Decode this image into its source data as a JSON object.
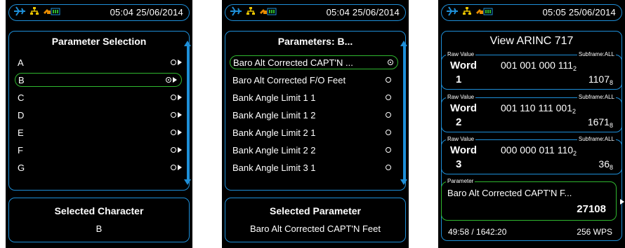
{
  "colors": {
    "accent_blue": "#1e8fd8",
    "selection_green": "#2fb72f",
    "background": "#000000",
    "text": "#ffffff"
  },
  "screen1": {
    "status": {
      "time": "05:04 25/06/2014",
      "icons": [
        "airplane-icon",
        "network-icon",
        "battery-icon"
      ]
    },
    "list_title": "Parameter Selection",
    "items": [
      {
        "label": "A",
        "selected": false
      },
      {
        "label": "B",
        "selected": true
      },
      {
        "label": "C",
        "selected": false
      },
      {
        "label": "D",
        "selected": false
      },
      {
        "label": "E",
        "selected": false
      },
      {
        "label": "F",
        "selected": false
      },
      {
        "label": "G",
        "selected": false
      }
    ],
    "footer_title": "Selected Character",
    "footer_value": "B"
  },
  "screen2": {
    "status": {
      "time": "05:04 25/06/2014"
    },
    "list_title": "Parameters: B...",
    "items": [
      {
        "label": "Baro Alt Corrected CAPT'N ...",
        "selected": true
      },
      {
        "label": "Baro Alt Corrected F/O  Feet",
        "selected": false
      },
      {
        "label": "Bank Angle Limit 1 1",
        "selected": false
      },
      {
        "label": "Bank Angle Limit 1 2",
        "selected": false
      },
      {
        "label": "Bank Angle Limit 2 1",
        "selected": false
      },
      {
        "label": "Bank Angle Limit 2 2",
        "selected": false
      },
      {
        "label": "Bank Angle Limit 3 1",
        "selected": false
      }
    ],
    "footer_title": "Selected Parameter",
    "footer_value": "Baro Alt Corrected CAPT'N  Feet"
  },
  "screen3": {
    "status": {
      "time": "05:05 25/06/2014"
    },
    "title": "View ARINC 717",
    "words": [
      {
        "legend_left": "Raw Value",
        "legend_right": "Subframe:ALL",
        "word_label": "Word",
        "index": "1",
        "binary": "001 001 000 111",
        "binary_base": "2",
        "octal": "1107",
        "octal_base": "8"
      },
      {
        "legend_left": "Raw Value",
        "legend_right": "Subframe:ALL",
        "word_label": "Word",
        "index": "2",
        "binary": "001 110 111 001",
        "binary_base": "2",
        "octal": "1671",
        "octal_base": "8"
      },
      {
        "legend_left": "Raw Value",
        "legend_right": "Subframe:ALL",
        "word_label": "Word",
        "index": "3",
        "binary": "000 000 011 110",
        "binary_base": "2",
        "octal": "36",
        "octal_base": "8"
      }
    ],
    "parameter": {
      "legend": "Parameter",
      "name": "Baro Alt Corrected CAPT'N  F...",
      "value": "27108"
    },
    "footer_left": "49:58 / 1642:20",
    "footer_right": "256 WPS"
  }
}
